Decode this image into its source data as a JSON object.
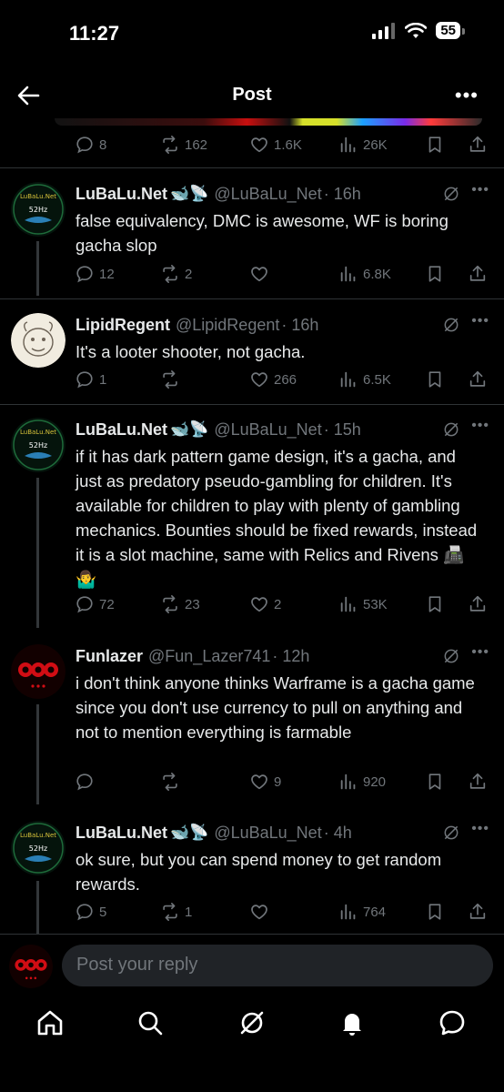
{
  "status_bar": {
    "time": "11:27",
    "battery": "55"
  },
  "header": {
    "title": "Post"
  },
  "parent_actions": {
    "replies": "8",
    "reposts": "162",
    "likes": "1.6K",
    "views": "26K"
  },
  "replies": [
    {
      "name": "LuBaLu.Net",
      "name_emoji": "🐋📡",
      "handle": "@LuBaLu_Net",
      "time": "· 16h",
      "text": "false equivalency, DMC is awesome, WF is boring gacha slop",
      "replies": "12",
      "reposts": "2",
      "likes": "",
      "views": "6.8K",
      "avatar": "52hz-whale"
    },
    {
      "name": "LipidRegent",
      "name_emoji": "",
      "handle": "@LipidRegent",
      "time": "· 16h",
      "text": "It's a looter shooter, not gacha.",
      "replies": "1",
      "reposts": "",
      "likes": "266",
      "views": "6.5K",
      "avatar": "sketch-face"
    },
    {
      "name": "LuBaLu.Net",
      "name_emoji": "🐋📡",
      "handle": "@LuBaLu_Net",
      "time": "· 15h",
      "text": "if it has dark pattern game design, it's a gacha, and just as predatory pseudo-gambling for children. It's available for children to play with plenty of gambling mechanics. Bounties should be fixed rewards, instead it is a slot machine, same with Relics and Rivens 📠🤷‍♂️",
      "replies": "72",
      "reposts": "23",
      "likes": "2",
      "views": "53K",
      "avatar": "52hz-whale"
    },
    {
      "name": "Funlazer",
      "name_emoji": "",
      "handle": "@Fun_Lazer741",
      "time": "· 12h",
      "text": "i don't think anyone thinks Warframe is a gacha game since you don't use currency to pull on anything and not to mention everything is farmable",
      "replies": "",
      "reposts": "",
      "likes": "9",
      "views": "920",
      "avatar": "red-eyes"
    },
    {
      "name": "LuBaLu.Net",
      "name_emoji": "🐋📡",
      "handle": "@LuBaLu_Net",
      "time": "· 4h",
      "text": "ok sure, but you can spend money to get random rewards.",
      "replies": "5",
      "reposts": "1",
      "likes": "",
      "views": "764",
      "avatar": "52hz-whale"
    }
  ],
  "avatar_text": {
    "logo_top": "LuBaLu.Net",
    "logo_mid": "52Hz"
  },
  "reply_input": {
    "placeholder": "Post your reply"
  },
  "nav": [
    "home-icon",
    "search-icon",
    "grok-icon",
    "notifications-icon",
    "messages-icon"
  ],
  "colors": {
    "muted": "#71767b",
    "text": "#e7e9ea",
    "divider": "#2f3336"
  }
}
